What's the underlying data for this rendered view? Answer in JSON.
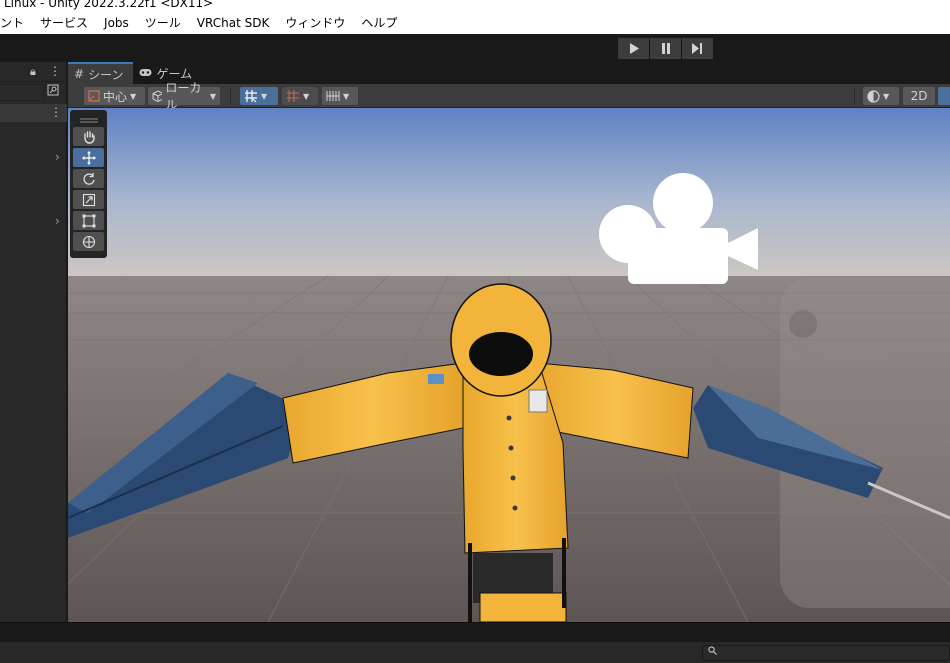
{
  "window": {
    "title": "Linux - Unity 2022.3.22f1 <DX11>"
  },
  "menu": [
    "ント",
    "サービス",
    "Jobs",
    "ツール",
    "VRChat SDK",
    "ウィンドウ",
    "ヘルプ"
  ],
  "play_controls": {
    "play": "play-icon",
    "pause": "pause-icon",
    "step": "step-icon"
  },
  "left_panel": {
    "lock": "lock-icon",
    "menu": "⋮",
    "search_placeholder": ""
  },
  "tabs": [
    {
      "label": "シーン",
      "icon": "grid-icon",
      "active": true
    },
    {
      "label": "ゲーム",
      "icon": "gamepad-icon",
      "active": false
    }
  ],
  "scene_toolbar": {
    "pivot_label": "中心",
    "space_label": "ローカル",
    "mode_2d": "2D",
    "accent": "#4a6f9c"
  },
  "tools": [
    "hand-icon",
    "move-icon",
    "rotate-icon",
    "scale-icon",
    "rect-icon",
    "transform-icon"
  ],
  "colors": {
    "sky_top": "#5e82c4",
    "horizon": "#c9c4bf",
    "ground": "#6a6160",
    "raincoat": "#f3b93f",
    "umbrella": "#2a4a77"
  }
}
